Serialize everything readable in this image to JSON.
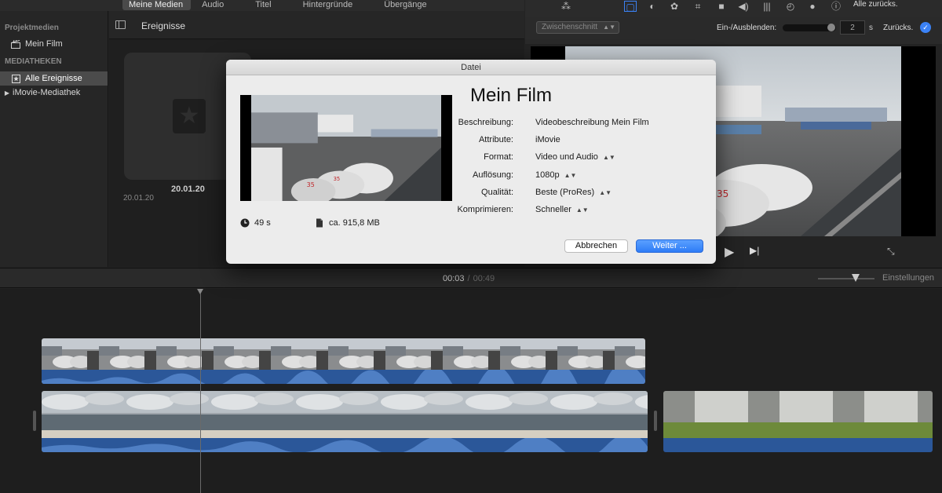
{
  "media_tabs": [
    "Meine Medien",
    "Audio",
    "Titel",
    "Hintergründe",
    "Übergänge"
  ],
  "sidebar": {
    "section_project": "Projektmedien",
    "project_item": "Mein Film",
    "section_libraries": "MEDIATHEKEN",
    "all_events": "Alle Ereignisse",
    "library": "iMovie-Mediathek"
  },
  "browser": {
    "title": "Ereignisse",
    "event_date_bold": "20.01.20",
    "event_date": "20.01.20"
  },
  "viewer": {
    "reset_all": "Alle zurücks.",
    "transition_select": "Zwischenschnitt",
    "fade_label": "Ein-/Ausblenden:",
    "fade_value": "2",
    "fade_unit": "s",
    "reset": "Zurücks."
  },
  "timeline": {
    "current_time": "00:03",
    "separator": "/",
    "total_time": "00:49",
    "settings": "Einstellungen"
  },
  "dialog": {
    "window_title": "Datei",
    "heading": "Mein Film",
    "fields": [
      {
        "label": "Beschreibung:",
        "value": "Videobeschreibung Mein Film",
        "stepper": false
      },
      {
        "label": "Attribute:",
        "value": "iMovie",
        "stepper": false
      },
      {
        "label": "Format:",
        "value": "Video und Audio",
        "stepper": true
      },
      {
        "label": "Auflösung:",
        "value": "1080p",
        "stepper": true
      },
      {
        "label": "Qualität:",
        "value": "Beste (ProRes)",
        "stepper": true
      },
      {
        "label": "Komprimieren:",
        "value": "Schneller",
        "stepper": true
      }
    ],
    "duration": "49 s",
    "size": "ca. 915,8 MB",
    "cancel": "Abbrechen",
    "continue": "Weiter ..."
  },
  "colors": {
    "accent": "#3b82f6",
    "audio": "#2b5799"
  }
}
